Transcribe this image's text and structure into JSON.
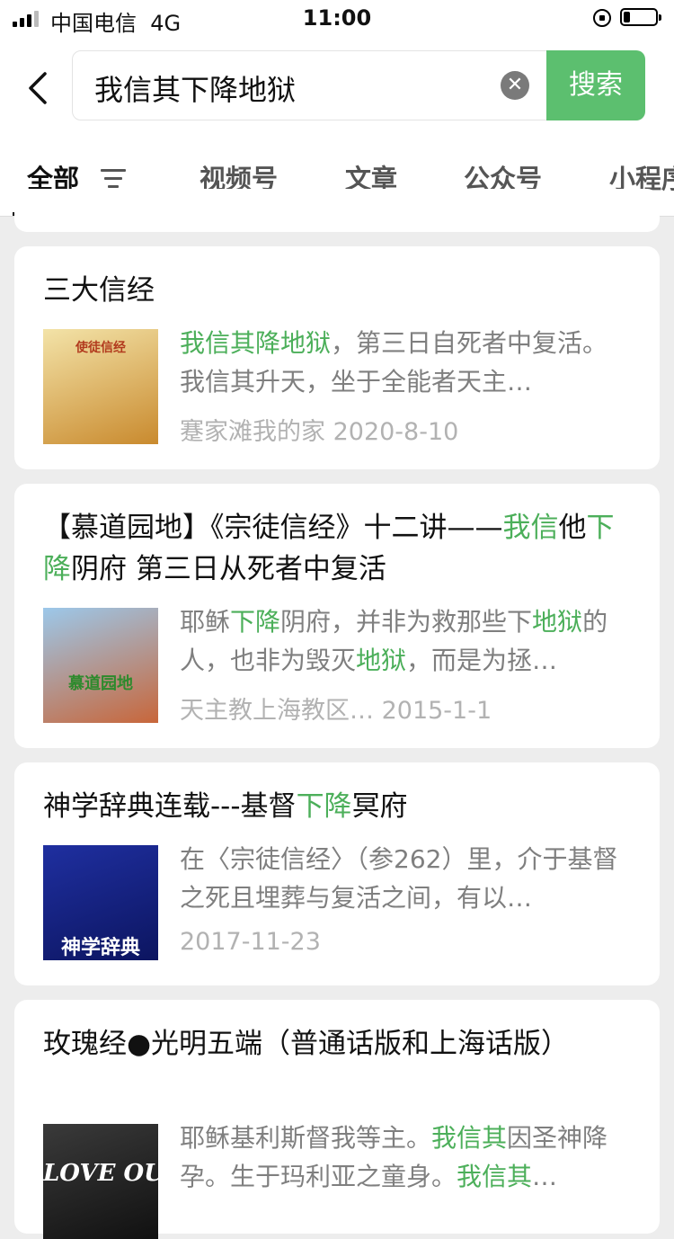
{
  "status_bar": {
    "carrier": "中国电信",
    "network": "4G",
    "time": "11:00",
    "battery_level": 0.2
  },
  "search": {
    "query": "我信其下降地狱",
    "button_label": "搜索"
  },
  "tabs": [
    {
      "label": "全部",
      "active": true
    },
    {
      "label": "视频号"
    },
    {
      "label": "文章"
    },
    {
      "label": "公众号"
    },
    {
      "label": "小程序"
    }
  ],
  "results": [
    {
      "title": [
        {
          "t": "三大信经"
        }
      ],
      "snippet": [
        {
          "t": "我信其降地狱",
          "hl": true
        },
        {
          "t": "，第三日自死者中复活。我信其升天，坐于全能者天主…"
        }
      ],
      "meta": "蹇家滩我的家  2020-8-10",
      "thumb": {
        "text": "使徒信经",
        "colors": [
          "#f3e3a8",
          "#c98a2e"
        ]
      }
    },
    {
      "title": [
        {
          "t": "【慕道园地】《宗徒信经》十二讲——"
        },
        {
          "t": "我信",
          "hl": true
        },
        {
          "t": "他"
        },
        {
          "t": "下降",
          "hl": true
        },
        {
          "t": "阴府 第三日从死者中复活"
        }
      ],
      "snippet": [
        {
          "t": "耶稣"
        },
        {
          "t": "下降",
          "hl": true
        },
        {
          "t": "阴府，并非为救那些下"
        },
        {
          "t": "地狱",
          "hl": true
        },
        {
          "t": "的人，也非为毁灭"
        },
        {
          "t": "地狱",
          "hl": true
        },
        {
          "t": "，而是为拯…"
        }
      ],
      "meta": "天主教上海教区…  2015-1-1",
      "thumb": {
        "text": "慕道园地",
        "colors": [
          "#9cc8ea",
          "#c8663a"
        ]
      }
    },
    {
      "title": [
        {
          "t": "神学辞典连载---基督"
        },
        {
          "t": "下降",
          "hl": true
        },
        {
          "t": "冥府"
        }
      ],
      "snippet": [
        {
          "t": "在〈宗徒信经〉（参262）里，介于基督之死且埋葬与复活之间，有以…"
        }
      ],
      "meta": "2017-11-23",
      "thumb": {
        "text": "神学辞典",
        "colors": [
          "#1f2fa0",
          "#0c1560"
        ]
      }
    },
    {
      "title": [
        {
          "t": "玫瑰经●光明五端（普通话版和上海话版）"
        }
      ],
      "snippet": [
        {
          "t": "耶稣基利斯督我等主。"
        },
        {
          "t": "我信其",
          "hl": true
        },
        {
          "t": "因圣神降孕。生于玛利亚之童身。"
        },
        {
          "t": "我信其",
          "hl": true
        },
        {
          "t": "…"
        }
      ],
      "meta": "",
      "thumb": {
        "text": "LOVE OU",
        "colors": [
          "#3a3a3a",
          "#111111"
        ]
      }
    }
  ]
}
